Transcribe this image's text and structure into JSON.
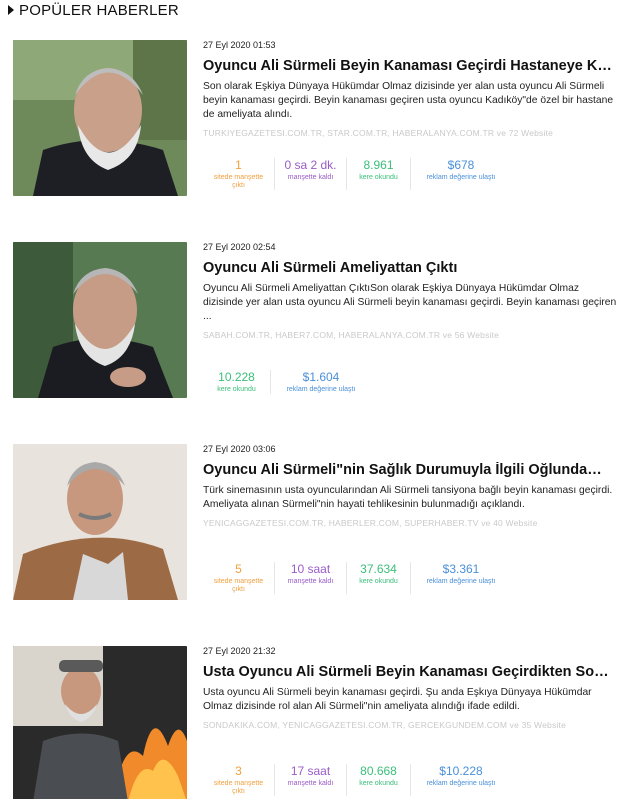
{
  "section_title": "POPÜLER HABERLER",
  "articles": [
    {
      "date": "27 Eyl 2020 01:53",
      "title": "Oyuncu Ali Sürmeli Beyin Kanaması Geçirdi Hastaneye K…",
      "summary": "Son olarak Eşkiya Dünyaya Hükümdar Olmaz dizisinde yer alan usta oyuncu Ali Sürmeli beyin kanaması geçirdi. Beyin kanaması geçiren usta oyuncu Kadıköy\"de özel bir hastane de ameliyata alındı.",
      "sources": "TURKIYEGAZETESI.COM.TR, STAR.COM.TR, HABERALANYA.COM.TR ve 72 Website",
      "stats": [
        {
          "value": "1",
          "label": "sitede manşette çıktı",
          "color": "orange"
        },
        {
          "value": "0 sa 2 dk.",
          "label": "manşette kaldı",
          "color": "purple"
        },
        {
          "value": "8.961",
          "label": "kere okundu",
          "color": "green"
        },
        {
          "value": "$678",
          "label": "reklam değerine ulaştı",
          "color": "blue"
        }
      ]
    },
    {
      "date": "27 Eyl 2020 02:54",
      "title": "Oyuncu Ali Sürmeli Ameliyattan Çıktı",
      "summary": "Oyuncu Ali Sürmeli Ameliyattan ÇıktıSon olarak Eşkiya Dünyaya Hükümdar Olmaz dizisinde yer alan usta oyuncu Ali Sürmeli beyin kanaması geçirdi. Beyin kanaması geçiren ...",
      "sources": "SABAH.COM.TR, HABER7.COM, HABERALANYA.COM.TR ve 56 Website",
      "stats": [
        {
          "value": "10.228",
          "label": "kere okundu",
          "color": "green"
        },
        {
          "value": "$1.604",
          "label": "reklam değerine ulaştı",
          "color": "blue"
        }
      ]
    },
    {
      "date": "27 Eyl 2020 03:06",
      "title": "Oyuncu Ali Sürmeli\"nin Sağlık Durumuyla İlgili Oğlunda…",
      "summary": "Türk sinemasının usta oyuncularından Ali Sürmeli tansiyona bağlı beyin kanaması geçirdi. Ameliyata alınan Sürmeli\"nin hayati tehlikesinin bulunmadığı açıklandı.",
      "sources": "YENICAGGAZETESI.COM.TR, HABERLER.COM, SUPERHABER.TV ve 40 Website",
      "stats": [
        {
          "value": "5",
          "label": "sitede manşette çıktı",
          "color": "orange"
        },
        {
          "value": "10 saat",
          "label": "manşette kaldı",
          "color": "purple"
        },
        {
          "value": "37.634",
          "label": "kere okundu",
          "color": "green"
        },
        {
          "value": "$3.361",
          "label": "reklam değerine ulaştı",
          "color": "blue"
        }
      ]
    },
    {
      "date": "27 Eyl 2020 21:32",
      "title": "Usta Oyuncu Ali Sürmeli Beyin Kanaması Geçirdikten So…",
      "summary": "Usta oyuncu Ali Sürmeli beyin kanaması geçirdi. Şu anda Eşkıya Dünyaya Hükümdar Olmaz dizisinde rol alan Ali Sürmeli\"nin ameliyata alındığı ifade edildi.",
      "sources": "SONDAKIKA.COM, YENICAGGAZETESI.COM.TR, GERCEKGUNDEM.COM ve 35 Website",
      "stats": [
        {
          "value": "3",
          "label": "sitede manşette çıktı",
          "color": "orange"
        },
        {
          "value": "17 saat",
          "label": "manşette kaldı",
          "color": "purple"
        },
        {
          "value": "80.668",
          "label": "kere okundu",
          "color": "green"
        },
        {
          "value": "$10.228",
          "label": "reklam değerine ulaştı",
          "color": "blue"
        }
      ]
    }
  ]
}
